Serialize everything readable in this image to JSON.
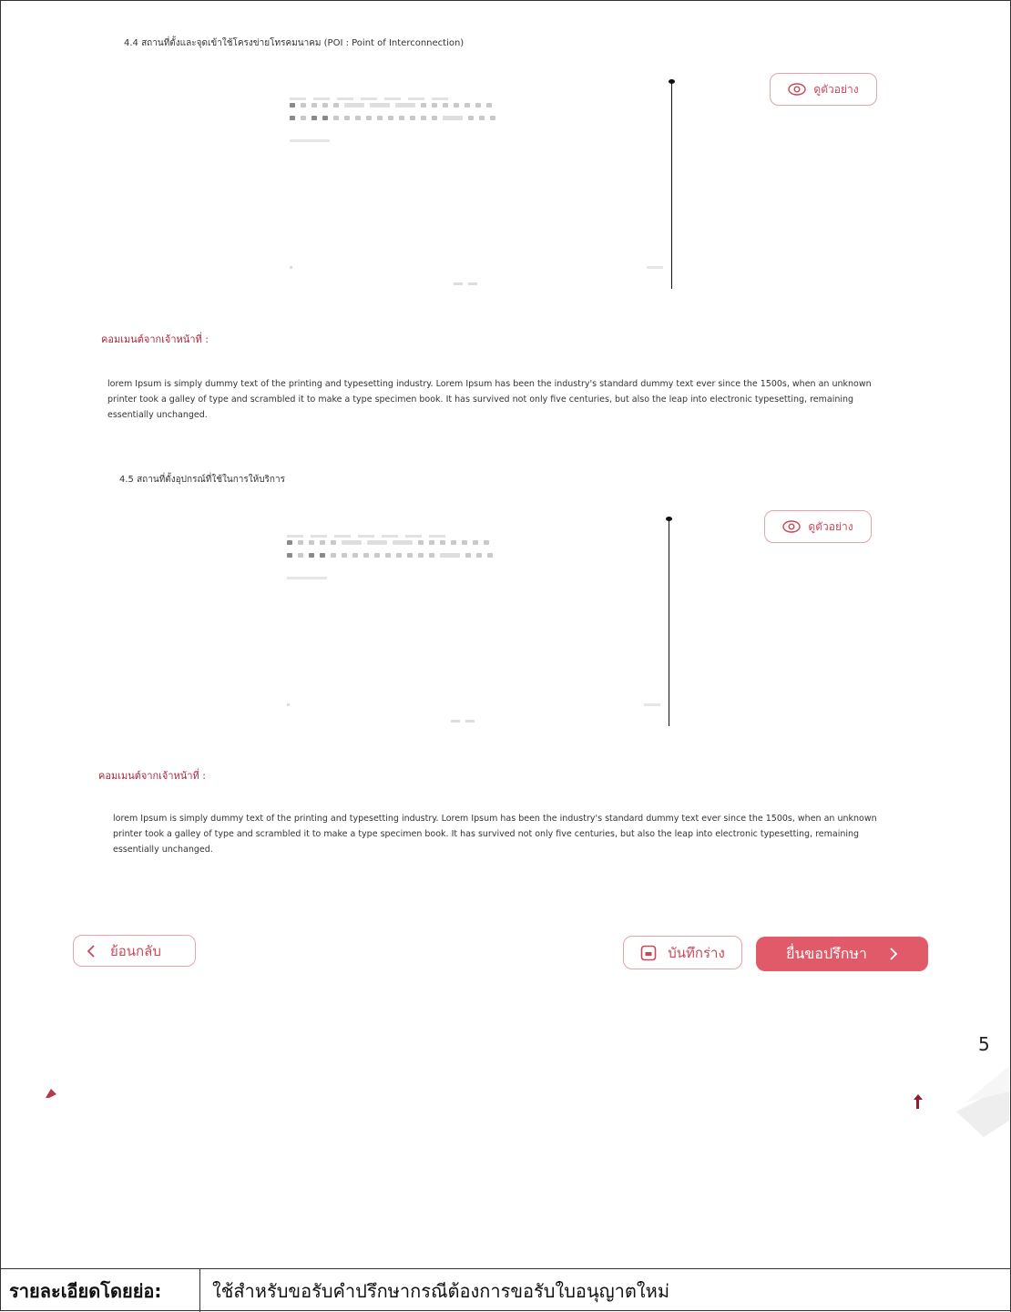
{
  "sections": [
    {
      "title": "4.4 สถานที่ตั้งและจุดเข้าใช้โครงข่ายโทรคมนาคม (POI : Point of Interconnection)",
      "preview_label": "ดูตัวอย่าง",
      "comment_label": "คอมเมนต์จากเจ้าหน้าที่ :",
      "comment_text": "lorem Ipsum is simply dummy text of the printing and typesetting industry. Lorem Ipsum has been the industry's standard dummy text ever since the 1500s, when an unknown printer took a galley of type and scrambled it to make a type specimen book. It has survived not only five centuries, but also the leap into electronic typesetting, remaining essentially unchanged."
    },
    {
      "title": "4.5 สถานที่ตั้งอุปกรณ์ที่ใช้ในการให้บริการ",
      "preview_label": "ดูตัวอย่าง",
      "comment_label": "คอมเมนต์จากเจ้าหน้าที่ :",
      "comment_text": "lorem Ipsum is simply dummy text of the printing and typesetting industry. Lorem Ipsum has been the industry's standard dummy text ever since the 1500s, when an unknown printer took a galley of type and scrambled it to make a type specimen book. It has survived not only five centuries, but also the leap into electronic typesetting, remaining essentially unchanged."
    }
  ],
  "actions": {
    "back_label": "ย้อนกลับ",
    "draft_label": "บันทึกร่าง",
    "submit_label": "ยื่นขอปรึกษา"
  },
  "stray_marks": {
    "page_number_fragment": "5"
  },
  "summary_table": {
    "label": "รายละเอียดโดยย่อ:",
    "value": "ใช้สำหรับขอรับคำปรึกษากรณีต้องการขอรับใบอนุญาตใหม่"
  },
  "colors": {
    "accent": "#e05a6a",
    "accent_text": "#c9485a",
    "comment_label": "#b0243b"
  },
  "icons": [
    "eye-icon",
    "chevron-left-icon",
    "save-draft-icon",
    "chevron-right-icon"
  ]
}
